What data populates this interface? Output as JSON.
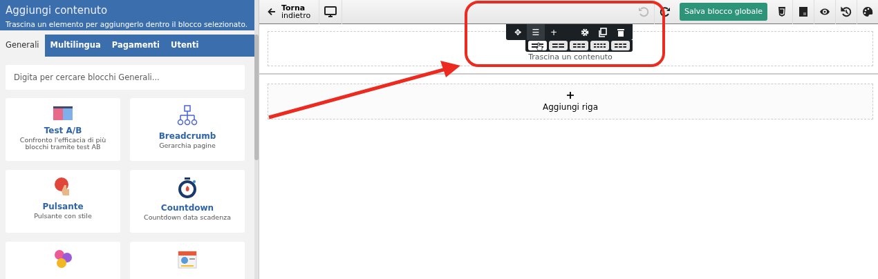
{
  "sidebar": {
    "title": "Aggiungi contenuto",
    "subtitle": "Trascina un elemento per aggiungerlo dentro il blocco selezionato.",
    "tabs": [
      {
        "label": "Generali",
        "selected": true
      },
      {
        "label": "Multilingua",
        "selected": false
      },
      {
        "label": "Pagamenti",
        "selected": false
      },
      {
        "label": "Utenti",
        "selected": false
      }
    ],
    "search": {
      "placeholder": "Digita per cercare blocchi Generali..."
    },
    "blocks": [
      {
        "kind": "full",
        "title": "Test A/B",
        "description": "Confronto l'efficacia di più blocchi tramite test AB"
      },
      {
        "kind": "full",
        "title": "Breadcrumb",
        "description": "Gerarchia pagine"
      },
      {
        "kind": "full",
        "title": "Pulsante",
        "description": "Pulsante con stile"
      },
      {
        "kind": "full",
        "title": "Countdown",
        "description": "Countdown data scadenza"
      },
      {
        "kind": "cut_off"
      },
      {
        "kind": "cut_off"
      }
    ]
  },
  "toolbar": {
    "back": {
      "line_1": "Torna",
      "line_2": "indietro"
    },
    "undo": {
      "disabled": true
    },
    "redo": {
      "disabled": false
    },
    "save_button": "Salva blocco globale"
  },
  "canvas": {
    "row_placeholder": "Trascina un contenuto",
    "add_row": {
      "icon": "+",
      "label": "Aggiungi riga"
    },
    "row_toolbar": {
      "actions": [
        "✥",
        "☰",
        "+"
      ],
      "layouts": [
        {
          "selected": true
        },
        {
          "selected": false
        },
        {
          "selected": false
        },
        {
          "selected": false
        },
        {
          "selected": false
        }
      ]
    }
  }
}
